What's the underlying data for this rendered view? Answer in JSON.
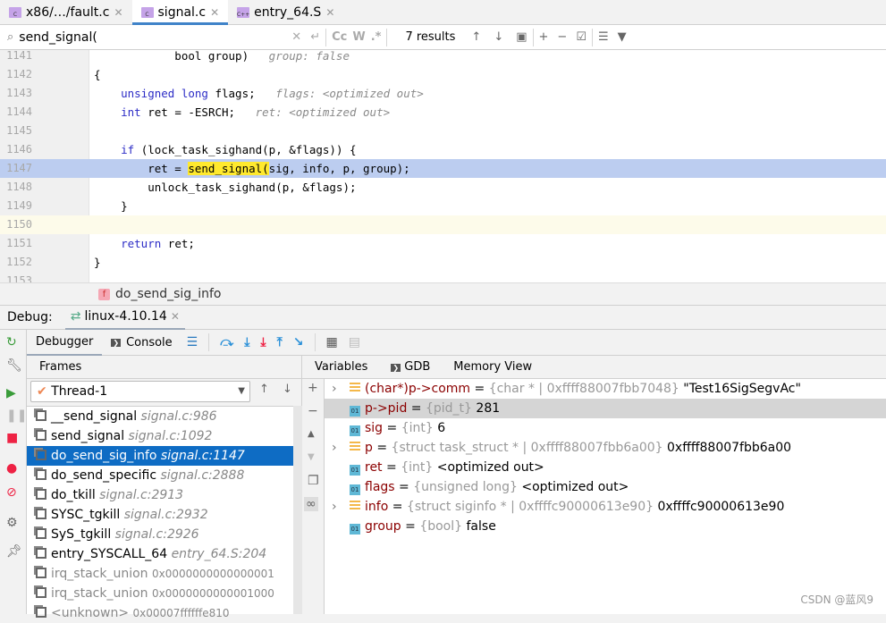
{
  "tabs": [
    {
      "label": "x86/…/fault.c",
      "icon": "c-file-icon"
    },
    {
      "label": "signal.c",
      "icon": "c-file-icon",
      "active": true
    },
    {
      "label": "entry_64.S",
      "icon": "cpp-file-icon"
    }
  ],
  "search": {
    "query": "send_signal(",
    "results": "7 results",
    "case_label": "Cc",
    "word_label": "W",
    "regex_label": ".*"
  },
  "code": [
    {
      "n": "1141",
      "parts": [
        [
          "",
          "            bool group)"
        ],
        [
          "hint",
          "   group: false"
        ]
      ]
    },
    {
      "n": "1142",
      "parts": [
        [
          "",
          "{"
        ]
      ]
    },
    {
      "n": "1143",
      "parts": [
        [
          "",
          "    "
        ],
        [
          "kw",
          "unsigned long"
        ],
        [
          "",
          " flags;"
        ],
        [
          "hint",
          "   flags: <optimized out>"
        ]
      ]
    },
    {
      "n": "1144",
      "parts": [
        [
          "",
          "    "
        ],
        [
          "kw",
          "int"
        ],
        [
          "",
          " ret = -ESRCH;"
        ],
        [
          "hint",
          "   ret: <optimized out>"
        ]
      ]
    },
    {
      "n": "1145",
      "parts": []
    },
    {
      "n": "1146",
      "parts": [
        [
          "",
          "    "
        ],
        [
          "kw",
          "if"
        ],
        [
          "",
          " (lock_task_sighand(p, &flags)) {"
        ]
      ]
    },
    {
      "n": "1147",
      "exec": true,
      "parts": [
        [
          "",
          "        ret = "
        ],
        [
          "hl",
          "send_signal("
        ],
        [
          "",
          "sig, info, p, group);"
        ]
      ]
    },
    {
      "n": "1148",
      "parts": [
        [
          "",
          "        unlock_task_sighand(p, &flags);"
        ]
      ]
    },
    {
      "n": "1149",
      "parts": [
        [
          "",
          "    }"
        ]
      ]
    },
    {
      "n": "1150",
      "current": true,
      "parts": []
    },
    {
      "n": "1151",
      "parts": [
        [
          "",
          "    "
        ],
        [
          "kw",
          "return"
        ],
        [
          "",
          " ret;"
        ]
      ]
    },
    {
      "n": "1152",
      "parts": [
        [
          "",
          "}"
        ]
      ]
    },
    {
      "n": "1153",
      "parts": []
    }
  ],
  "breadcrumb": {
    "badge": "f",
    "function": "do_send_sig_info"
  },
  "debug": {
    "label": "Debug:",
    "session": "linux-4.10.14"
  },
  "debugger_tabs": {
    "debugger": "Debugger",
    "console": "Console"
  },
  "frames": {
    "header": "Frames",
    "thread": "Thread-1",
    "items": [
      {
        "name": "__send_signal",
        "loc": "signal.c:986"
      },
      {
        "name": "send_signal",
        "loc": "signal.c:1092"
      },
      {
        "name": "do_send_sig_info",
        "loc": "signal.c:1147",
        "selected": true
      },
      {
        "name": "do_send_specific",
        "loc": "signal.c:2888"
      },
      {
        "name": "do_tkill",
        "loc": "signal.c:2913"
      },
      {
        "name": "SYSC_tgkill",
        "loc": "signal.c:2932"
      },
      {
        "name": "SyS_tgkill",
        "loc": "signal.c:2926"
      },
      {
        "name": "entry_SYSCALL_64",
        "loc": "entry_64.S:204"
      },
      {
        "name": "irq_stack_union",
        "loc": "0x0000000000000001",
        "dim": true
      },
      {
        "name": "irq_stack_union",
        "loc": "0x0000000000001000",
        "dim": true
      },
      {
        "name": "<unknown>",
        "loc": "0x00007ffffffe810",
        "dim": true
      }
    ]
  },
  "variables": {
    "tabs": {
      "variables": "Variables",
      "gdb": "GDB",
      "memory": "Memory View"
    },
    "items": [
      {
        "name": "(char*)p->comm",
        "type": "{char * | 0xffff88007fbb7048}",
        "value": "\"Test16SigSegvAc\"",
        "expandable": true
      },
      {
        "name": "p->pid",
        "type": "{pid_t}",
        "value": "281",
        "selected": true
      },
      {
        "name": "sig",
        "type": "{int}",
        "value": "6"
      },
      {
        "name": "p",
        "type": "{struct task_struct * | 0xffff88007fbb6a00}",
        "value": "0xffff88007fbb6a00",
        "expandable": true
      },
      {
        "name": "ret",
        "type": "{int}",
        "value": "<optimized out>"
      },
      {
        "name": "flags",
        "type": "{unsigned long}",
        "value": "<optimized out>"
      },
      {
        "name": "info",
        "type": "{struct siginfo * | 0xffffc90000613e90}",
        "value": "0xffffc90000613e90",
        "expandable": true
      },
      {
        "name": "group",
        "type": "{bool}",
        "value": "false"
      }
    ]
  },
  "watermark": "CSDN @蓝风9"
}
